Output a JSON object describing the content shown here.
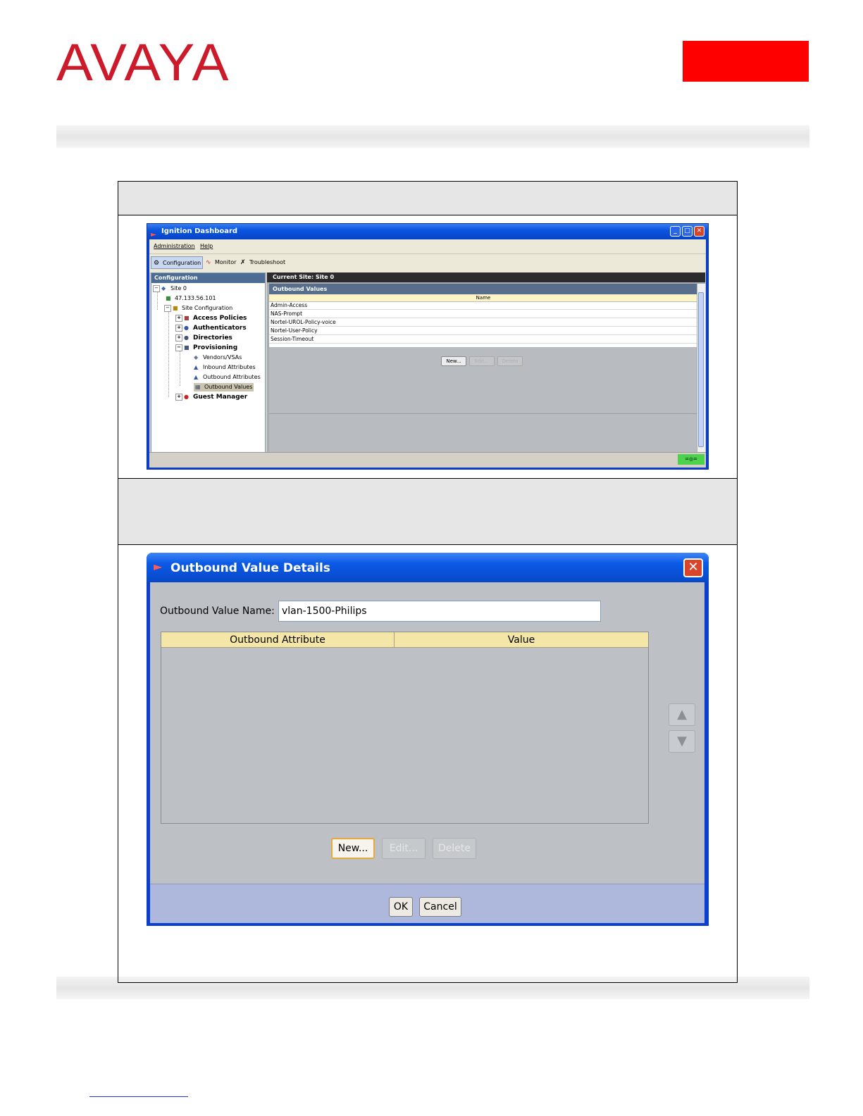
{
  "brand": {
    "logo_text": "AVAYA",
    "accent_color": "#cc1a2b",
    "box_color": "#ff0000"
  },
  "dashboard": {
    "title": "Ignition Dashboard",
    "menu": [
      "Administration",
      "Help"
    ],
    "toolbar": [
      "Configuration",
      "Monitor",
      "Troubleshoot"
    ],
    "left_header": "Configuration",
    "tree": {
      "site": "Site 0",
      "ip": "47.133.56.101",
      "site_config": "Site Configuration",
      "access_policies": "Access Policies",
      "authenticators": "Authenticators",
      "directories": "Directories",
      "provisioning": "Provisioning",
      "vendors": "Vendors/VSAs",
      "inbound": "Inbound Attributes",
      "outbound_attr": "Outbound Attributes",
      "outbound_values": "Outbound Values",
      "guest_manager": "Guest Manager"
    },
    "current_site": "Current Site:  Site 0",
    "panel_title": "Outbound Values",
    "column": "Name",
    "rows": [
      "Admin-Access",
      "NAS-Prompt",
      "Nortel-UROL-Policy-voice",
      "Nortel-User-Policy",
      "Session-Timeout"
    ],
    "buttons": {
      "new": "New...",
      "edit": "Edit...",
      "delete": "Delete"
    }
  },
  "dialog": {
    "title": "Outbound Value Details",
    "name_label": "Outbound Value Name:",
    "name_value": "vlan-1500-Philips",
    "columns": [
      "Outbound Attribute",
      "Value"
    ],
    "buttons": {
      "new": "New...",
      "edit": "Edit...",
      "delete": "Delete"
    },
    "ok": "OK",
    "cancel": "Cancel"
  }
}
